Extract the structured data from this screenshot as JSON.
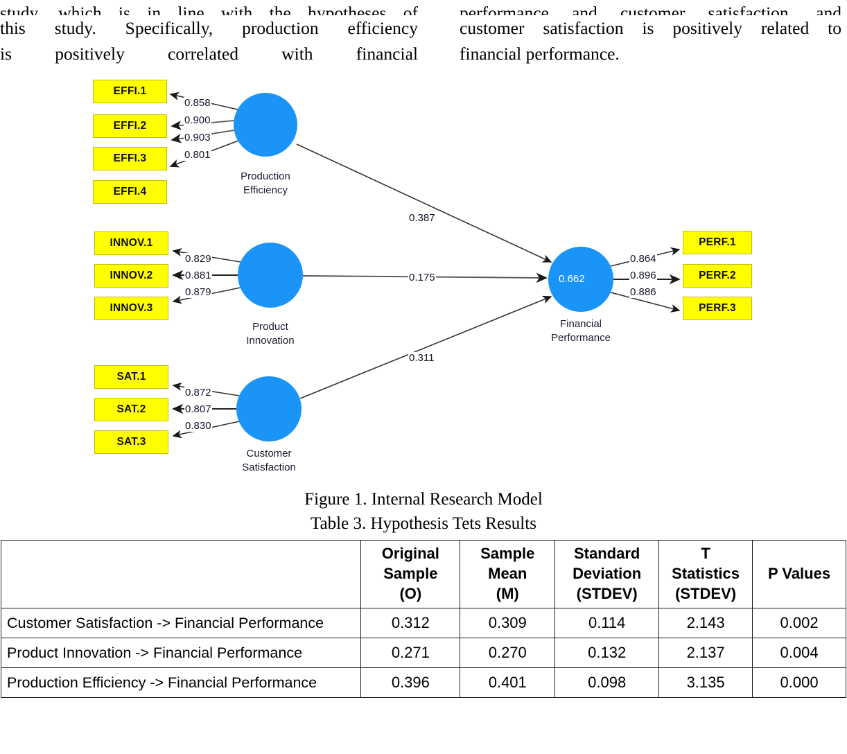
{
  "body_text": {
    "left_column": [
      "study, which is in line with the hypotheses of",
      "this study. Specifically, production efficiency",
      "is positively correlated with financial"
    ],
    "right_column": [
      "performance and customer satisfaction, and",
      "customer satisfaction is positively related to",
      "financial performance."
    ]
  },
  "figure": {
    "caption": "Figure 1. Internal Research Model",
    "latent_variables": [
      {
        "id": "production-efficiency",
        "label_line1": "Production",
        "label_line2": "Efficiency",
        "r2": ""
      },
      {
        "id": "product-innovation",
        "label_line1": "Product",
        "label_line2": "Innovation",
        "r2": ""
      },
      {
        "id": "customer-satisfaction",
        "label_line1": "Customer",
        "label_line2": "Satisfaction",
        "r2": ""
      },
      {
        "id": "financial-performance",
        "label_line1": "Financial",
        "label_line2": "Performance",
        "r2": "0.662"
      }
    ],
    "indicators": {
      "efficiency": [
        "EFFI.1",
        "EFFI.2",
        "EFFI.3",
        "EFFI.4"
      ],
      "innovation": [
        "INNOV.1",
        "INNOV.2",
        "INNOV.3"
      ],
      "satisfaction": [
        "SAT.1",
        "SAT.2",
        "SAT.3"
      ],
      "performance": [
        "PERF.1",
        "PERF.2",
        "PERF.3"
      ]
    },
    "outer_loadings": {
      "efficiency": [
        "0.858",
        "0.900",
        "0.903",
        "0.801"
      ],
      "innovation": [
        "0.829",
        "0.881",
        "0.879"
      ],
      "satisfaction": [
        "0.872",
        "0.807",
        "0.830"
      ],
      "performance": [
        "0.864",
        "0.896",
        "0.886"
      ]
    },
    "path_coefficients": {
      "efficiency_to_performance": "0.387",
      "innovation_to_performance": "0.175",
      "satisfaction_to_performance": "0.311"
    },
    "colors": {
      "indicator_fill": "#FFFF00",
      "indicator_border": "#BFBF00",
      "latent_fill": "#1A94F7",
      "line": "#333333"
    }
  },
  "table": {
    "caption": "Table 3. Hypothesis Tets Results",
    "headers": [
      "",
      "Original Sample (O)",
      "Sample Mean (M)",
      "Standard Deviation (STDEV)",
      "T Statistics (STDEV)",
      "P Values"
    ],
    "header_lines": [
      [
        "",
        "",
        ""
      ],
      [
        "Original",
        "Sample",
        "(O)"
      ],
      [
        "Sample",
        "Mean",
        "(M)"
      ],
      [
        "Standard",
        "Deviation",
        "(STDEV)"
      ],
      [
        "T",
        "Statistics",
        "(STDEV)"
      ],
      [
        "",
        "P Values",
        ""
      ]
    ],
    "rows": [
      {
        "path": "Customer Satisfaction -> Financial Performance",
        "original_sample": "0.312",
        "sample_mean": "0.309",
        "standard_deviation": "0.114",
        "t_statistics": "2.143",
        "p_values": "0.002"
      },
      {
        "path": "Product Innovation -> Financial Performance",
        "original_sample": "0.271",
        "sample_mean": "0.270",
        "standard_deviation": "0.132",
        "t_statistics": "2.137",
        "p_values": "0.004"
      },
      {
        "path": "Production Efficiency -> Financial Performance",
        "original_sample": "0.396",
        "sample_mean": "0.401",
        "standard_deviation": "0.098",
        "t_statistics": "3.135",
        "p_values": "0.000"
      }
    ]
  }
}
